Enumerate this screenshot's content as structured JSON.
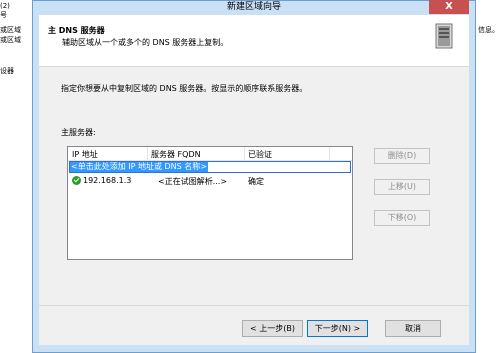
{
  "background": {
    "left_items": [
      "(2)",
      "号",
      "或区域",
      "或区域",
      "",
      "设器"
    ],
    "right_text": "信息。"
  },
  "dialog": {
    "title": "新建区域向导",
    "close_label": "X"
  },
  "header": {
    "title": "主 DNS 服务器",
    "subtitle": "辅助区域从一个或多个的 DNS 服务器上复制。"
  },
  "instruction": "指定你想要从中复制区域的 DNS 服务器。按显示的顺序联系服务器。",
  "primary_label": "主服务器:",
  "table": {
    "columns": [
      "IP 地址",
      "服务器 FQDN",
      "已验证"
    ],
    "add_placeholder": "<单击此处添加 IP 地址或 DNS 名称>",
    "rows": [
      {
        "ip": "192.168.1.3",
        "fqdn": "<正在试图解析...>",
        "verified": "确定"
      }
    ]
  },
  "side_buttons": {
    "delete": "删除(D)",
    "move_up": "上移(U)",
    "move_down": "下移(O)"
  },
  "nav": {
    "back": "< 上一步(B)",
    "next": "下一步(N) >",
    "cancel": "取消"
  },
  "colors": {
    "frame": "#c9e0f5",
    "close": "#c75050",
    "selection": "#3399ff",
    "ok_icon": "#2a9d2a"
  }
}
